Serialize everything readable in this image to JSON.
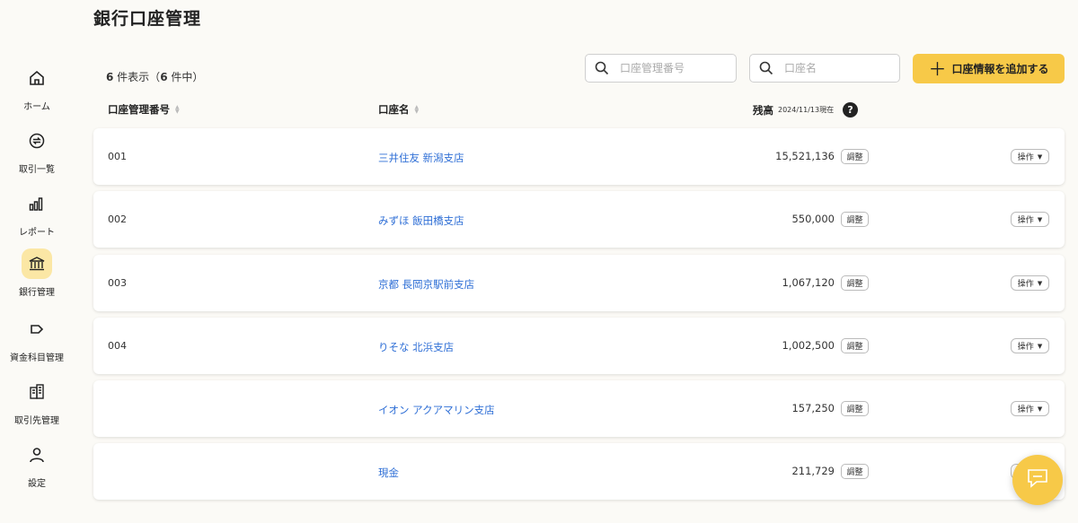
{
  "page": {
    "title": "銀行口座管理"
  },
  "sidebar": {
    "items": [
      {
        "label": "ホーム",
        "icon": "home-icon"
      },
      {
        "label": "取引一覧",
        "icon": "exchange-icon"
      },
      {
        "label": "レポート",
        "icon": "chart-bars-icon"
      },
      {
        "label": "銀行管理",
        "icon": "bank-icon",
        "active": true
      },
      {
        "label": "資金科目管理",
        "icon": "tag-icon"
      },
      {
        "label": "取引先管理",
        "icon": "building-icon"
      },
      {
        "label": "設定",
        "icon": "user-icon"
      }
    ]
  },
  "toolbar": {
    "count_shown": "6",
    "count_shown_suffix": " 件表示（",
    "count_total": "6",
    "count_total_suffix": " 件中）",
    "search_number_placeholder": "口座管理番号",
    "search_name_placeholder": "口座名",
    "add_button_label": "口座情報を追加する"
  },
  "table": {
    "headers": {
      "number": "口座管理番号",
      "name": "口座名",
      "balance": "残高",
      "balance_asof": "2024/11/13現在",
      "help": "?"
    },
    "adjust_label": "調整",
    "action_label": "操作",
    "rows": [
      {
        "number": "001",
        "name": "三井住友 新潟支店",
        "balance": "15,521,136"
      },
      {
        "number": "002",
        "name": "みずほ 飯田橋支店",
        "balance": "550,000"
      },
      {
        "number": "003",
        "name": "京都 長岡京駅前支店",
        "balance": "1,067,120"
      },
      {
        "number": "004",
        "name": "りそな 北浜支店",
        "balance": "1,002,500"
      },
      {
        "number": "",
        "name": "イオン アクアマリン支店",
        "balance": "157,250"
      },
      {
        "number": "",
        "name": "現金",
        "balance": "211,729"
      }
    ]
  },
  "colors": {
    "accent": "#f7c948",
    "link": "#2f6fd6",
    "active_nav_bg": "#fbe7a5"
  }
}
